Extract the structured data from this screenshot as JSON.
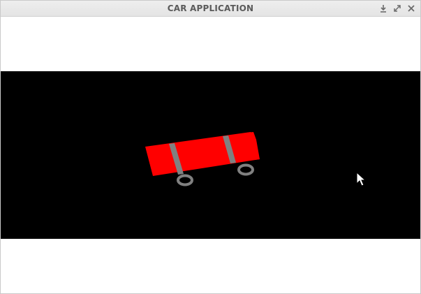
{
  "window": {
    "title": "CAR APPLICATION",
    "buttons": [
      "minimize-icon",
      "maximize-icon",
      "close-icon"
    ]
  },
  "scene": {
    "background_color": "#000000",
    "car": {
      "body_color": "#ff0000",
      "stripe_color": "#808080",
      "wheel_color": "#808080"
    }
  }
}
